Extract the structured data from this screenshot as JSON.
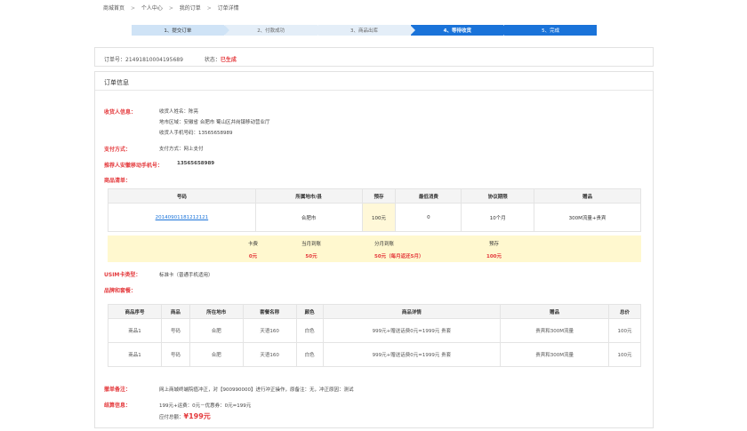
{
  "breadcrumb": [
    "商城首页",
    ">",
    "个人中心",
    ">",
    "我的订单",
    ">",
    "订单详情"
  ],
  "steps": [
    "1、提交订单",
    "2、付款成功",
    "3、商品出库",
    "4、等待收货",
    "5、完成"
  ],
  "order": {
    "number": "订单号：21491810004195689",
    "state_label": "状态：",
    "state_value": "已生成"
  },
  "section_title": "订单信息",
  "receiver": {
    "label": "收货人信息：",
    "name": "收货人姓名：陈亮",
    "area": "地市区域：安徽省 合肥市 蜀山区井岗镇移动营业厅",
    "phone": "收货人手机号码：13565658989"
  },
  "payment": {
    "label": "支付方式：",
    "value": "支付方式：网上支付"
  },
  "referrer": {
    "label": "推荐人安徽移动手机号：",
    "value": "13565658989"
  },
  "goods": {
    "label": "商品清单：",
    "headers": [
      "号码",
      "所属地市/县",
      "预存",
      "最低消费",
      "协议期限",
      "赠品"
    ],
    "row": [
      "20140901181212121",
      "合肥市",
      "100元",
      "0",
      "10个月",
      "300M流量+贵宾"
    ],
    "fees": [
      {
        "name": "卡费",
        "value": "0元"
      },
      {
        "name": "当月到账",
        "value": "50元"
      },
      {
        "name": "分月到账",
        "value": "50元（每月返还5月）"
      },
      {
        "name": "预存",
        "value": "100元"
      }
    ]
  },
  "usim": {
    "label": "USIM卡类型：",
    "value": "标准卡（普通手机适用）"
  },
  "brand": {
    "label": "品牌和套餐：",
    "headers": [
      "商品序号",
      "商品",
      "所在地市",
      "套餐名称",
      "颜色",
      "商品详情",
      "赠品",
      "总价"
    ],
    "rows": [
      [
        "商品1",
        "号码",
        "合肥",
        "天语160",
        "白色",
        "999元+赠送话费0元=1999元 贵套",
        "贵宾和300M流量",
        "100元"
      ],
      [
        "商品1",
        "号码",
        "合肥",
        "天语160",
        "白色",
        "999元+赠送话费0元=1999元 贵套",
        "贵宾和300M流量",
        "100元"
      ]
    ]
  },
  "remark": {
    "label": "撤单备注：",
    "value": "网上商城终端院值冲正，对【900990000】进行冲正操作，原备注：无，冲正原因：测试"
  },
  "settle": {
    "label": "结算信息：",
    "line1": "199元+运费：0元－优惠券：0元=199元",
    "line2_prefix": "应付总额：",
    "line2_value": "¥199元"
  }
}
